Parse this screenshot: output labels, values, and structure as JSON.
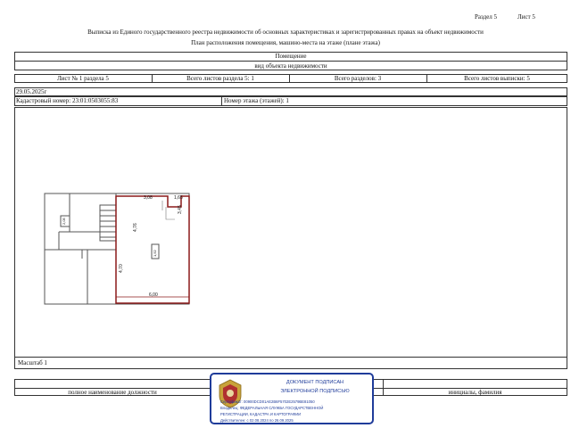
{
  "header": {
    "section": "Раздел 5",
    "sheet": "Лист 5",
    "title_line1": "Выписка из Единого государственного реестра недвижимости об основных характеристиках и зарегистрированных правах на объект недвижимости",
    "title_line2": "План расположения помещения, машино-места на этаже (плане этажа)"
  },
  "object_box": {
    "type": "Помещение",
    "subtitle": "вид объекта недвижимости"
  },
  "sheet_info": {
    "sheet_no": "Лист № 1 раздела 5",
    "sheets_in_section": "Всего листов раздела 5: 1",
    "sections_total": "Всего разделов: 3",
    "sheets_total": "Всего листов выписки: 5"
  },
  "date": "29.05.2025г",
  "cadastral": {
    "number": "Кадастровый номер: 23:01:0503055:83",
    "floor": "Номер этажа (этажей): 1"
  },
  "plan_labels": {
    "dim_top": "3,08",
    "dim_top_right": "1,65",
    "dim_right": "3,45",
    "dim_left_upper": "4,76",
    "dim_left_lower": "4,70",
    "dim_bottom": "6,00",
    "room_label": "1,52",
    "small_label": "2,05"
  },
  "scale": "Масштаб 1",
  "footer": {
    "position_label": "полное наименование должности",
    "initials_label": "инициалы, фамилия"
  },
  "stamp": {
    "line1": "ДОКУМЕНТ ПОДПИСАН",
    "line2": "ЭЛЕКТРОННОЙ ПОДПИСЬЮ",
    "cert": "Сертификат: 00900DCD01AE2B6F5702E2579BE81050",
    "owner1": "Владелец: ФЕДЕРАЛЬНАЯ СЛУЖБА ГОСУДАРСТВЕННОЙ",
    "owner2": "РЕГИСТРАЦИИ, КАДАСТРА И КАРТОГРАФИИ",
    "valid": "Действителен: с 02.08.2024 по 26.09.2025"
  },
  "colors": {
    "stamp_blue": "#1f3c9a",
    "plan_highlight": "#8b1a1a",
    "emblem_gold": "#c8a23a",
    "emblem_red": "#b03030"
  }
}
